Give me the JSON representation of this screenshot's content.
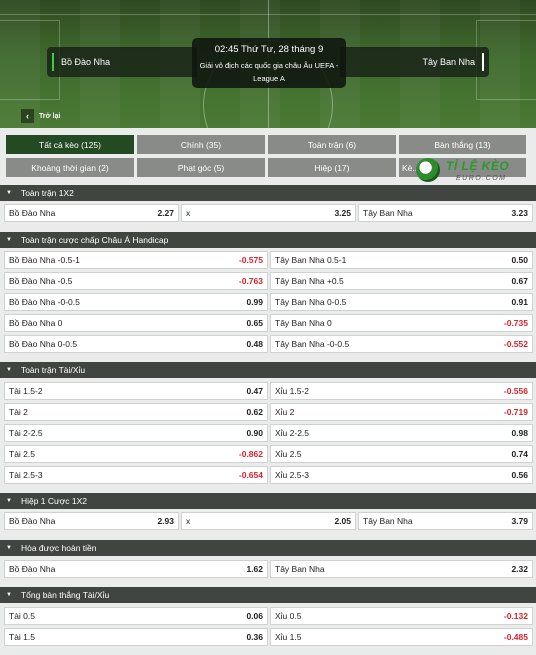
{
  "match": {
    "home": "Bồ Đào Nha",
    "away": "Tây Ban Nha",
    "time": "02:45 Thứ Tư, 28 tháng 9",
    "league": "Giải vô địch các quốc gia châu Âu UEFA - League A",
    "back_label": "Trở lại"
  },
  "tabs": [
    {
      "label": "Tất cả kèo (125)"
    },
    {
      "label": "Chính (35)"
    },
    {
      "label": "Toàn trận (6)"
    },
    {
      "label": "Bàn thắng (13)"
    },
    {
      "label": "Khoảng thời gian (2)"
    },
    {
      "label": "Phạt góc (5)"
    },
    {
      "label": "Hiệp (17)"
    },
    {
      "label": "Kè..."
    }
  ],
  "logo": {
    "text": "TỈ LỆ KÈO",
    "sub": "EURO.COM"
  },
  "sections": {
    "s1": {
      "title": "Toàn trận 1X2",
      "r0": {
        "a": "Bồ Đào Nha",
        "av": "2.27",
        "b": "x",
        "bv": "3.25",
        "c": "Tây Ban Nha",
        "cv": "3.23"
      }
    },
    "s2": {
      "title": "Toàn trận cược chấp Châu Á Handicap",
      "rows": [
        {
          "l": "Bồ Đào Nha -0.5-1",
          "lv": "-0.575",
          "r": "Tây Ban Nha 0.5-1",
          "rv": "0.50"
        },
        {
          "l": "Bồ Đào Nha -0.5",
          "lv": "-0.763",
          "r": "Tây Ban Nha +0.5",
          "rv": "0.67"
        },
        {
          "l": "Bồ Đào Nha -0-0.5",
          "lv": "0.99",
          "r": "Tây Ban Nha 0-0.5",
          "rv": "0.91"
        },
        {
          "l": "Bồ Đào Nha 0",
          "lv": "0.65",
          "r": "Tây Ban Nha 0",
          "rv": "-0.735"
        },
        {
          "l": "Bồ Đào Nha 0-0.5",
          "lv": "0.48",
          "r": "Tây Ban Nha -0-0.5",
          "rv": "-0.552"
        }
      ]
    },
    "s3": {
      "title": "Toàn trận Tài/Xỉu",
      "rows": [
        {
          "l": "Tài 1.5-2",
          "lv": "0.47",
          "r": "Xỉu 1.5-2",
          "rv": "-0.556"
        },
        {
          "l": "Tài 2",
          "lv": "0.62",
          "r": "Xỉu 2",
          "rv": "-0.719"
        },
        {
          "l": "Tài 2-2.5",
          "lv": "0.90",
          "r": "Xỉu 2-2.5",
          "rv": "0.98"
        },
        {
          "l": "Tài 2.5",
          "lv": "-0.862",
          "r": "Xỉu 2.5",
          "rv": "0.74"
        },
        {
          "l": "Tài 2.5-3",
          "lv": "-0.654",
          "r": "Xỉu 2.5-3",
          "rv": "0.56"
        }
      ]
    },
    "s4": {
      "title": "Hiệp 1 Cược 1X2",
      "r0": {
        "a": "Bồ Đào Nha",
        "av": "2.93",
        "b": "x",
        "bv": "2.05",
        "c": "Tây Ban Nha",
        "cv": "3.79"
      }
    },
    "s5": {
      "title": "Hòa được hoàn tiền",
      "rows": [
        {
          "l": "Bồ Đào Nha",
          "lv": "1.62",
          "r": "Tây Ban Nha",
          "rv": "2.32"
        }
      ]
    },
    "s6": {
      "title": "Tổng bàn thắng Tài/Xỉu",
      "rows": [
        {
          "l": "Tài 0.5",
          "lv": "0.06",
          "r": "Xỉu 0.5",
          "rv": "-0.132"
        },
        {
          "l": "Tài 1.5",
          "lv": "0.36",
          "r": "Xỉu 1.5",
          "rv": "-0.485"
        }
      ]
    }
  },
  "colors": {
    "header_bg": "#404542",
    "active_tab": "#244a24",
    "tab_bg": "#888b88",
    "negative": "#d8232a",
    "brand_green": "#2a9a2a"
  }
}
